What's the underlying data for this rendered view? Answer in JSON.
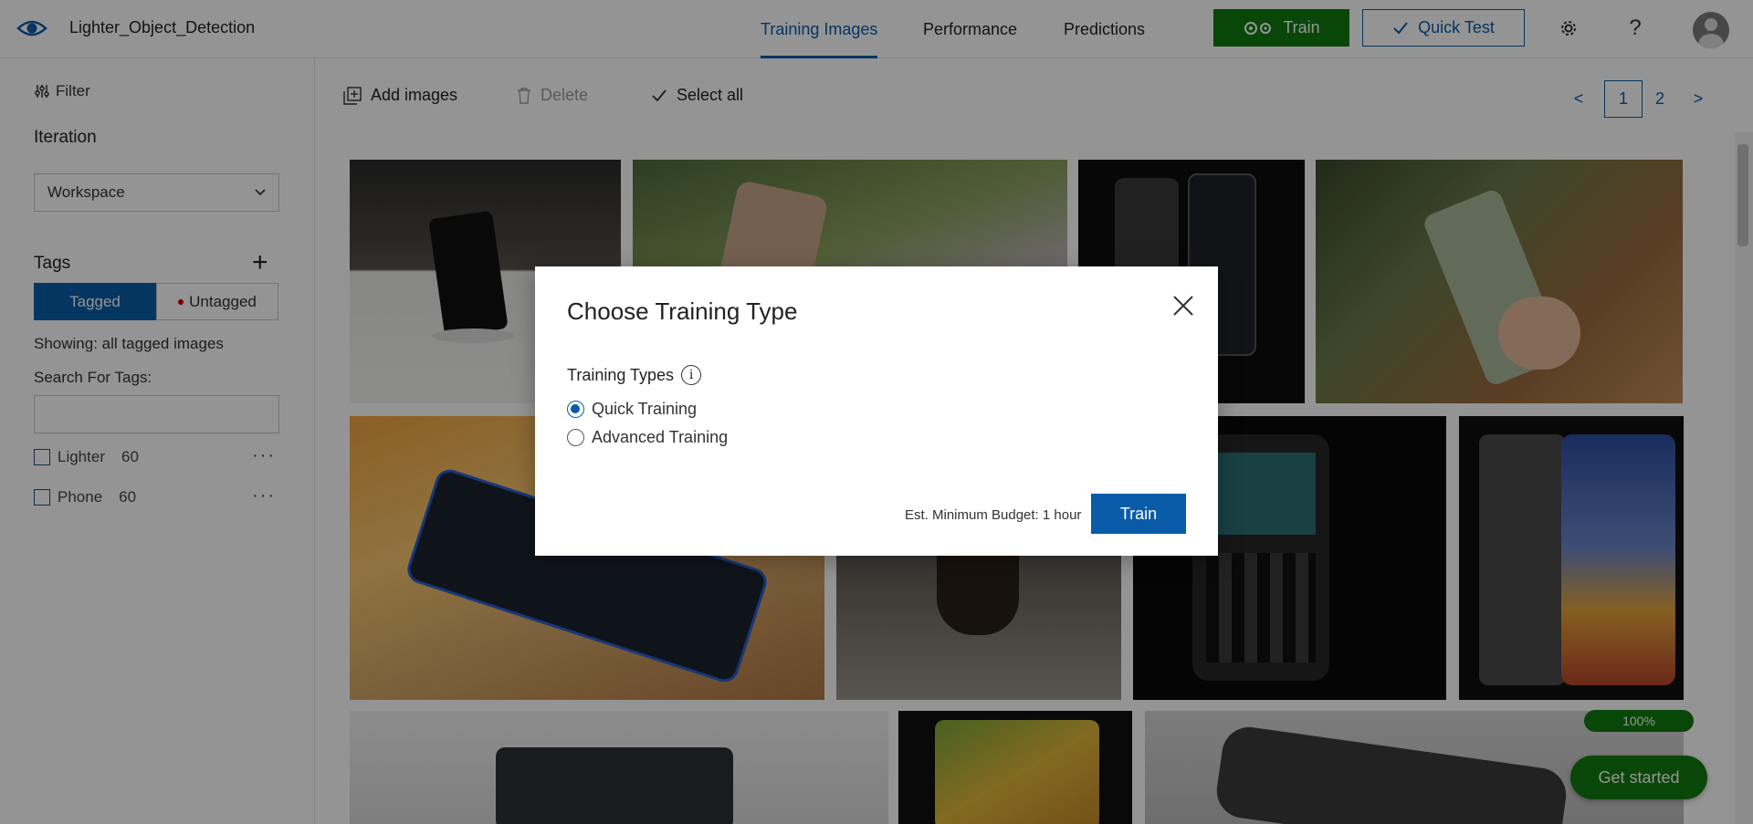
{
  "header": {
    "project_name": "Lighter_Object_Detection",
    "tabs": [
      {
        "label": "Training Images",
        "active": true
      },
      {
        "label": "Performance",
        "active": false
      },
      {
        "label": "Predictions",
        "active": false
      }
    ],
    "train_label": "Train",
    "quick_test_label": "Quick Test",
    "help_label": "?"
  },
  "sidebar": {
    "filter_label": "Filter",
    "iteration_heading": "Iteration",
    "iteration_value": "Workspace",
    "tags_heading": "Tags",
    "tagged_label": "Tagged",
    "untagged_label": "Untagged",
    "showing_text": "Showing: all tagged images",
    "search_label": "Search For Tags:",
    "search_value": "",
    "tags": [
      {
        "name": "Lighter",
        "count": "60"
      },
      {
        "name": "Phone",
        "count": "60"
      }
    ],
    "tag_more": "···"
  },
  "toolbar": {
    "add_images": "Add images",
    "delete": "Delete",
    "select_all": "Select all"
  },
  "pagination": {
    "prev": "<",
    "pages": [
      "1",
      "2"
    ],
    "current": "1",
    "next": ">"
  },
  "dialog": {
    "title": "Choose Training Type",
    "section_label": "Training Types",
    "info_glyph": "i",
    "options": [
      {
        "label": "Quick Training",
        "selected": true
      },
      {
        "label": "Advanced Training",
        "selected": false
      }
    ],
    "budget_text": "Est. Minimum Budget: 1 hour",
    "train_label": "Train"
  },
  "progress_text": "100%",
  "get_started_label": "Get started",
  "colors": {
    "accent_blue": "#0a5ca8",
    "train_green": "#0f7b0f",
    "overlay": "rgba(0,0,0,0.42)"
  }
}
